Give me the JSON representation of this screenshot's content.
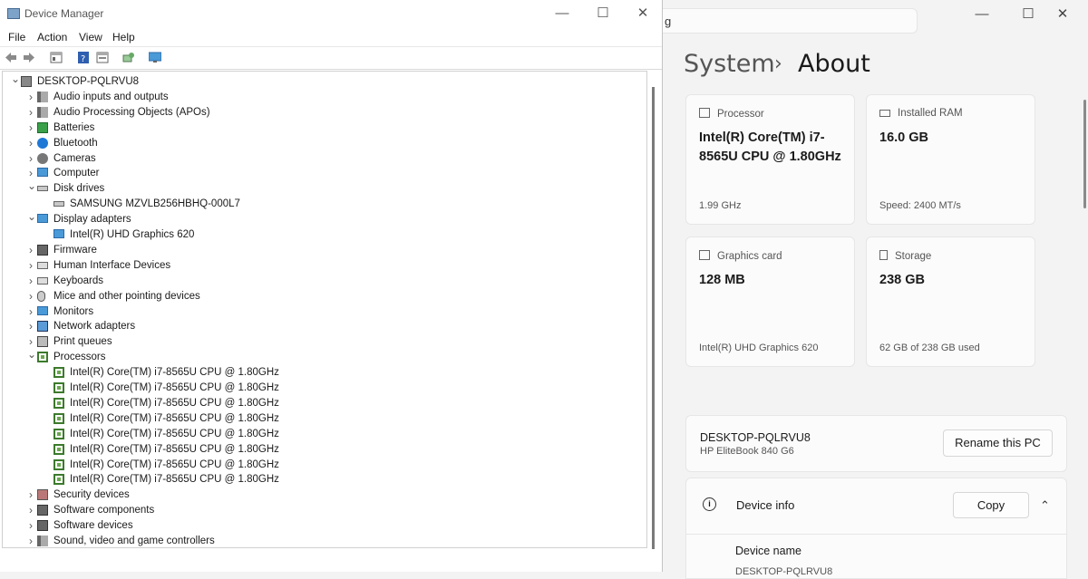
{
  "settings": {
    "search_partial": "g",
    "window_controls": {
      "minimize": "—",
      "maximize": "☐",
      "close": "✕"
    },
    "breadcrumb": {
      "parent": "System",
      "separator": "›",
      "current": "About"
    },
    "specs": [
      {
        "header": "Processor",
        "value": "Intel(R) Core(TM) i7-8565U CPU @ 1.80GHz",
        "footer": "1.99 GHz"
      },
      {
        "header": "Installed RAM",
        "value": "16.0 GB",
        "footer": "Speed: 2400 MT/s"
      },
      {
        "header": "Graphics card",
        "value": "128 MB",
        "footer": "Intel(R) UHD Graphics 620"
      },
      {
        "header": "Storage",
        "value": "238 GB",
        "footer": "62 GB of 238 GB used"
      }
    ],
    "pc_name": "DESKTOP-PQLRVU8",
    "pc_model": "HP EliteBook 840 G6",
    "rename_button": "Rename this PC",
    "device_info_title": "Device info",
    "copy_button": "Copy",
    "collapse_chevron": "⌃",
    "device_name_label": "Device name",
    "device_name_value_partial": "DESKTOP-PQLRVU8"
  },
  "device_manager": {
    "title": "Device Manager",
    "window_controls": {
      "minimize": "—",
      "maximize": "☐",
      "close": "✕"
    },
    "menu": [
      "File",
      "Action",
      "View",
      "Help"
    ],
    "root": "DESKTOP-PQLRVU8",
    "tree": [
      {
        "label": "Audio inputs and outputs",
        "icon": "speaker-icon",
        "expanded": false,
        "children": []
      },
      {
        "label": "Audio Processing Objects (APOs)",
        "icon": "speaker-icon",
        "expanded": false,
        "children": []
      },
      {
        "label": "Batteries",
        "icon": "battery-icon",
        "expanded": false,
        "children": []
      },
      {
        "label": "Bluetooth",
        "icon": "bluetooth-icon",
        "expanded": false,
        "children": []
      },
      {
        "label": "Cameras",
        "icon": "camera-icon",
        "expanded": false,
        "children": []
      },
      {
        "label": "Computer",
        "icon": "monitor-icon",
        "expanded": false,
        "children": []
      },
      {
        "label": "Disk drives",
        "icon": "disk-icon",
        "expanded": true,
        "children": [
          "SAMSUNG MZVLB256HBHQ-000L7"
        ]
      },
      {
        "label": "Display adapters",
        "icon": "monitor-icon",
        "expanded": true,
        "children": [
          "Intel(R) UHD Graphics 620"
        ]
      },
      {
        "label": "Firmware",
        "icon": "chip-icon",
        "expanded": false,
        "children": []
      },
      {
        "label": "Human Interface Devices",
        "icon": "keyboard-icon",
        "expanded": false,
        "children": []
      },
      {
        "label": "Keyboards",
        "icon": "keyboard-icon",
        "expanded": false,
        "children": []
      },
      {
        "label": "Mice and other pointing devices",
        "icon": "mouse-icon",
        "expanded": false,
        "children": []
      },
      {
        "label": "Monitors",
        "icon": "monitor-icon",
        "expanded": false,
        "children": []
      },
      {
        "label": "Network adapters",
        "icon": "network-icon",
        "expanded": false,
        "children": []
      },
      {
        "label": "Print queues",
        "icon": "printer-icon",
        "expanded": false,
        "children": []
      },
      {
        "label": "Processors",
        "icon": "processor-icon",
        "expanded": true,
        "children": [
          "Intel(R) Core(TM) i7-8565U CPU @ 1.80GHz",
          "Intel(R) Core(TM) i7-8565U CPU @ 1.80GHz",
          "Intel(R) Core(TM) i7-8565U CPU @ 1.80GHz",
          "Intel(R) Core(TM) i7-8565U CPU @ 1.80GHz",
          "Intel(R) Core(TM) i7-8565U CPU @ 1.80GHz",
          "Intel(R) Core(TM) i7-8565U CPU @ 1.80GHz",
          "Intel(R) Core(TM) i7-8565U CPU @ 1.80GHz",
          "Intel(R) Core(TM) i7-8565U CPU @ 1.80GHz"
        ]
      },
      {
        "label": "Security devices",
        "icon": "security-icon",
        "expanded": false,
        "children": []
      },
      {
        "label": "Software components",
        "icon": "chip-icon",
        "expanded": false,
        "children": []
      },
      {
        "label": "Software devices",
        "icon": "chip-icon",
        "expanded": false,
        "children": []
      },
      {
        "label": "Sound, video and game controllers",
        "icon": "speaker-icon",
        "expanded": false,
        "children": []
      }
    ]
  }
}
